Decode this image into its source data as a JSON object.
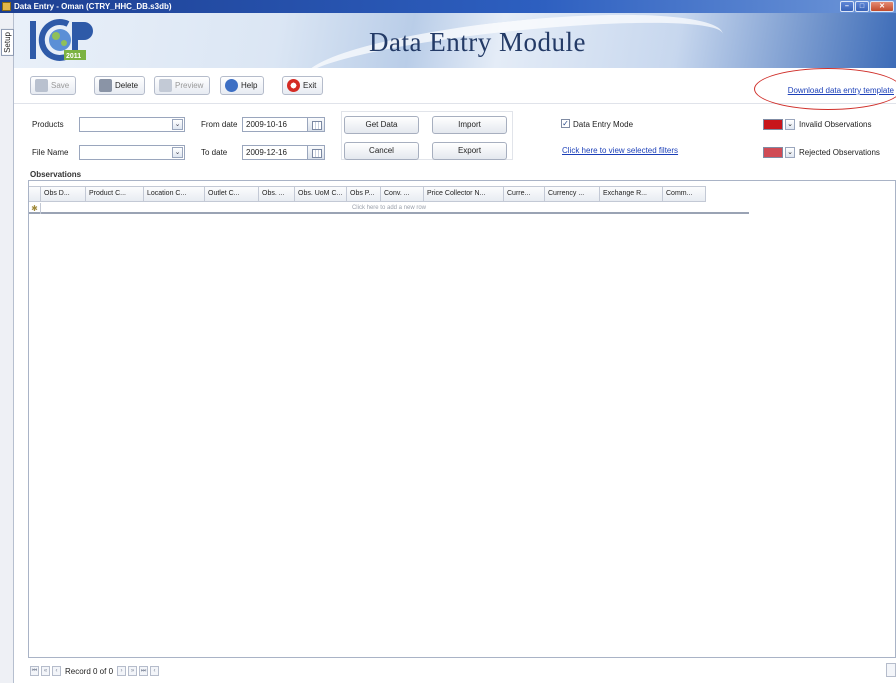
{
  "window": {
    "title": "Data Entry - Oman (CTRY_HHC_DB.s3db)",
    "min_label": "–",
    "max_label": "□",
    "close_label": "✕"
  },
  "side_tab": {
    "label": "Setup"
  },
  "banner": {
    "logo_text": "ICP",
    "logo_year": "2011",
    "title": "Data Entry Module"
  },
  "toolbar": {
    "save": "Save",
    "delete": "Delete",
    "preview": "Preview",
    "help": "Help",
    "exit": "Exit",
    "download_link": "Download data entry template"
  },
  "filters": {
    "products_label": "Products",
    "products_value": "",
    "file_name_label": "File Name",
    "file_name_value": "",
    "from_date_label": "From date",
    "from_date_value": "2009-10-16",
    "to_date_label": "To date",
    "to_date_value": "2009-12-16",
    "get_data": "Get Data",
    "cancel": "Cancel",
    "import": "Import",
    "export": "Export",
    "data_entry_mode_label": "Data Entry Mode",
    "data_entry_mode_checked": true,
    "view_filters_link": "Click here to view selected filters",
    "invalid_label": "Invalid Observations",
    "invalid_color": "#c8151b",
    "rejected_label": "Rejected Observations",
    "rejected_color": "#d04b55"
  },
  "observations": {
    "label": "Observations",
    "columns": [
      "Obs D...",
      "Product C...",
      "Location C...",
      "Outlet C...",
      "Obs. ...",
      "Obs. UoM C...",
      "Obs P...",
      "Conv. ...",
      "Price Collector N...",
      "Curre...",
      "Currency ...",
      "Exchange R...",
      "Comm..."
    ],
    "new_row_text": "Click here to add a new row"
  },
  "navigator": {
    "record_text": "Record 0 of 0"
  }
}
